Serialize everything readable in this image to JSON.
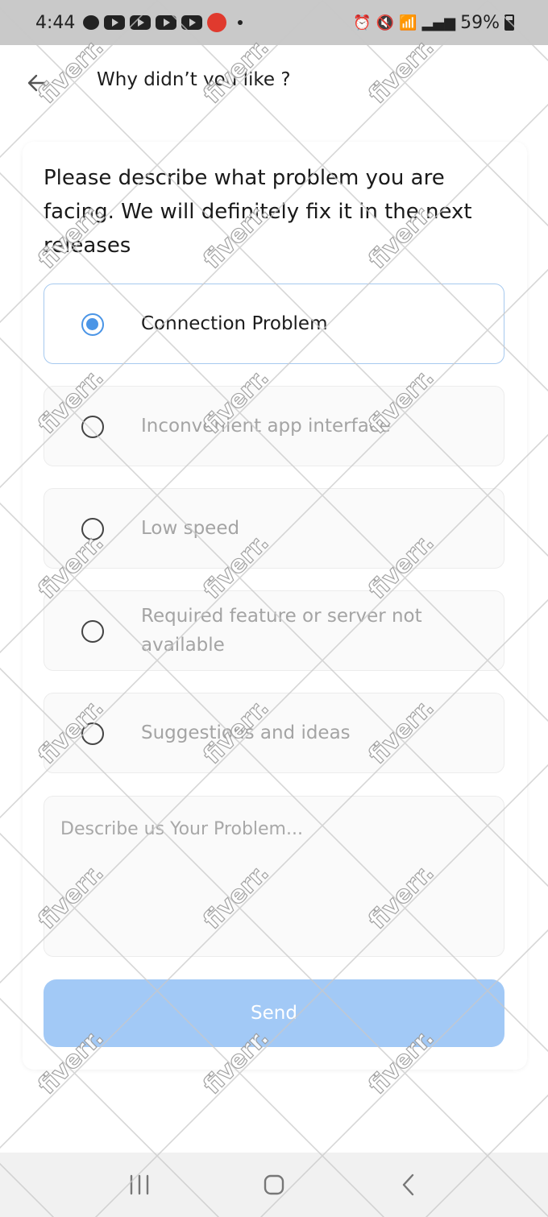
{
  "status_bar": {
    "time": "4:44",
    "battery": "59%"
  },
  "header": {
    "title": "Why didn’t you like ?"
  },
  "question": "Please describe what problem you are facing. We will definitely fix it in the next releases",
  "options": [
    {
      "label": "Connection Problem",
      "selected": true
    },
    {
      "label": "Inconvenient app interface",
      "selected": false
    },
    {
      "label": "Low speed",
      "selected": false
    },
    {
      "label": "Required feature or server not available",
      "selected": false
    },
    {
      "label": "Suggestions and ideas",
      "selected": false
    }
  ],
  "description": {
    "placeholder": "Describe us Your Problem...",
    "value": ""
  },
  "send_label": "Send",
  "watermark_text": "fiverr.",
  "colors": {
    "accent": "#4b95e6",
    "send_button": "#a2c9f6",
    "status_bar": "#c9c9c9",
    "nav_bar": "#f1f1f1"
  },
  "icons": [
    "back-arrow-icon",
    "radio-selected-icon",
    "radio-unselected-icon",
    "recents-icon",
    "home-icon",
    "nav-back-icon"
  ]
}
